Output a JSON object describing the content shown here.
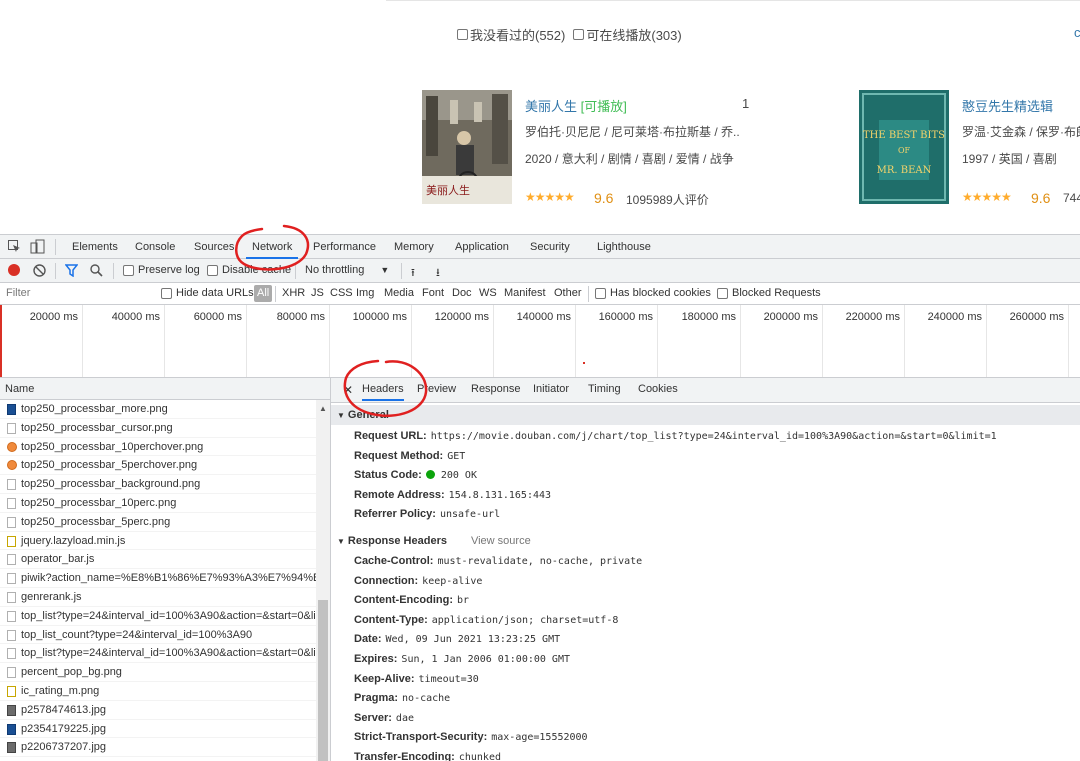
{
  "web": {
    "filter_unwatched": "我没看过的(552)",
    "filter_playable": "可在线播放(303)",
    "movies": [
      {
        "title": "美丽人生",
        "play_tag": "[可播放]",
        "rank": "1",
        "cast": "罗伯托·贝尼尼 / 尼可莱塔·布拉斯基 / 乔...",
        "info": "2020 / 意大利 / 剧情 / 喜剧 / 爱情 / 战争",
        "stars": "★★★★★",
        "score": "9.6",
        "votes": "1095989人评价",
        "poster_text": "美丽人生"
      },
      {
        "title": "憨豆先生精选辑",
        "cast": "罗温·艾金森 / 保罗·布朗",
        "info": "1997 / 英国 / 喜剧",
        "stars": "★★★★★",
        "score": "9.6",
        "votes": "744",
        "poster_text_1": "THE BEST BITS",
        "poster_text_2": "OF",
        "poster_text_3": "MR. BEAN"
      }
    ]
  },
  "devtools": {
    "tabs": [
      "Elements",
      "Console",
      "Sources",
      "Network",
      "Performance",
      "Memory",
      "Application",
      "Security",
      "Lighthouse"
    ],
    "active_tab": "Network",
    "toolbar": {
      "preserve_log": "Preserve log",
      "disable_cache": "Disable cache",
      "throttling": "No throttling"
    },
    "filterbar": {
      "filter_placeholder": "Filter",
      "hide_data_urls": "Hide data URLs",
      "types": [
        "All",
        "XHR",
        "JS",
        "CSS",
        "Img",
        "Media",
        "Font",
        "Doc",
        "WS",
        "Manifest",
        "Other"
      ],
      "has_blocked_cookies": "Has blocked cookies",
      "blocked_requests": "Blocked Requests"
    },
    "timeline_ticks": [
      "20000 ms",
      "40000 ms",
      "60000 ms",
      "80000 ms",
      "100000 ms",
      "120000 ms",
      "140000 ms",
      "160000 ms",
      "180000 ms",
      "200000 ms",
      "220000 ms",
      "240000 ms",
      "260000 ms"
    ],
    "list_header": "Name",
    "requests": [
      "top250_processbar_more.png",
      "top250_processbar_cursor.png",
      "top250_processbar_10perchover.png",
      "top250_processbar_5perchover.png",
      "top250_processbar_background.png",
      "top250_processbar_10perc.png",
      "top250_processbar_5perc.png",
      "jquery.lazyload.min.js",
      "operator_bar.js",
      "piwik?action_name=%E8%B1%86%E7%93%A3%E7%94%B5E",
      "genrerank.js",
      "top_list?type=24&interval_id=100%3A90&action=&start=0&li",
      "top_list_count?type=24&interval_id=100%3A90",
      "top_list?type=24&interval_id=100%3A90&action=&start=0&li",
      "percent_pop_bg.png",
      "ic_rating_m.png",
      "p2578474613.jpg",
      "p2354179225.jpg",
      "p2206737207.jpg"
    ],
    "detail_tabs": [
      "Headers",
      "Preview",
      "Response",
      "Initiator",
      "Timing",
      "Cookies"
    ],
    "general": {
      "title": "General",
      "rows": [
        {
          "k": "Request URL:",
          "v": "https://movie.douban.com/j/chart/top_list?type=24&interval_id=100%3A90&action=&start=0&limit=1"
        },
        {
          "k": "Request Method:",
          "v": "GET"
        },
        {
          "k": "Status Code:",
          "v": "200 OK"
        },
        {
          "k": "Remote Address:",
          "v": "154.8.131.165:443"
        },
        {
          "k": "Referrer Policy:",
          "v": "unsafe-url"
        }
      ]
    },
    "response_headers": {
      "title": "Response Headers",
      "view_source": "View source",
      "rows": [
        {
          "k": "Cache-Control:",
          "v": "must-revalidate, no-cache, private"
        },
        {
          "k": "Connection:",
          "v": "keep-alive"
        },
        {
          "k": "Content-Encoding:",
          "v": "br"
        },
        {
          "k": "Content-Type:",
          "v": "application/json; charset=utf-8"
        },
        {
          "k": "Date:",
          "v": "Wed, 09 Jun 2021 13:23:25 GMT"
        },
        {
          "k": "Expires:",
          "v": "Sun, 1 Jan 2006 01:00:00 GMT"
        },
        {
          "k": "Keep-Alive:",
          "v": "timeout=30"
        },
        {
          "k": "Pragma:",
          "v": "no-cache"
        },
        {
          "k": "Server:",
          "v": "dae"
        },
        {
          "k": "Strict-Transport-Security:",
          "v": "max-age=15552000"
        },
        {
          "k": "Transfer-Encoding:",
          "v": "chunked"
        }
      ]
    }
  },
  "colors": {
    "link": "#3377aa",
    "playable": "#42bd56",
    "star": "#ffac2d",
    "devtools_accent": "#1a73e8",
    "record": "#d93025",
    "annotation": "#e02020"
  }
}
